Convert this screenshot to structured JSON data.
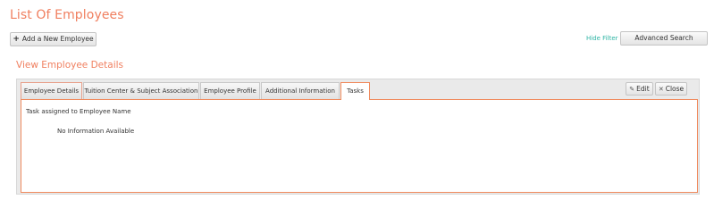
{
  "header": {
    "title": "List Of Employees"
  },
  "toolbar": {
    "add_label": "Add a New Employee",
    "hide_filter": "Hide Filter",
    "advanced_search": "Advanced Search"
  },
  "section": {
    "title": "View Employee Details"
  },
  "tabs": [
    {
      "label": "Employee Details"
    },
    {
      "label": "Tuition Center & Subject Association"
    },
    {
      "label": "Employee Profile"
    },
    {
      "label": "Additional Information"
    },
    {
      "label": "Tasks",
      "active": true
    }
  ],
  "actions": {
    "edit": "Edit",
    "close": "Close"
  },
  "content": {
    "heading": "Task assigned to Employee Name",
    "empty": "No Information Available"
  },
  "icons": {
    "add": "plus-icon",
    "edit": "pencil-icon",
    "close": "close-icon"
  },
  "colors": {
    "accent": "#f07f5f",
    "link": "#2bb3a3",
    "active_border": "#f08a5d"
  }
}
